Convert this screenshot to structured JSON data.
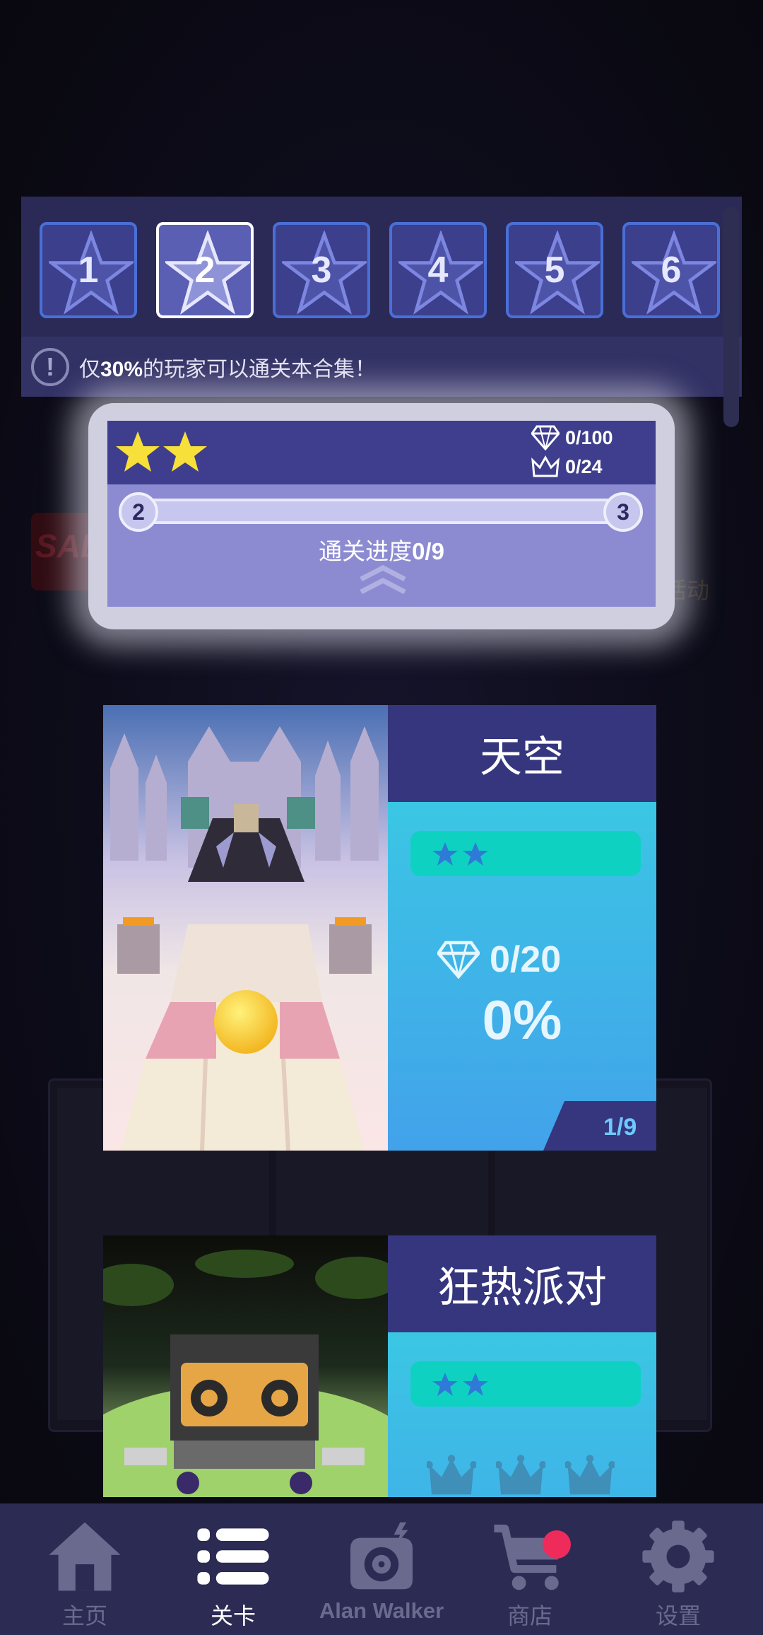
{
  "level_selector": {
    "levels": [
      {
        "number": "1",
        "active": false
      },
      {
        "number": "2",
        "active": true
      },
      {
        "number": "3",
        "active": false
      },
      {
        "number": "4",
        "active": false
      },
      {
        "number": "5",
        "active": false
      },
      {
        "number": "6",
        "active": false
      }
    ],
    "notice": {
      "prefix": "仅",
      "highlight": "30%",
      "suffix": "的玩家可以通关本合集！"
    }
  },
  "progress_card": {
    "stars_earned": 2,
    "gems": "0/100",
    "crowns": "0/24",
    "track_start": "2",
    "track_end": "3",
    "progress_label": "通关进度",
    "progress_value": "0/9"
  },
  "cards": [
    {
      "title": "天空",
      "stars": 2,
      "gems": "0/20",
      "percent": "0%",
      "count": "1/9"
    },
    {
      "title": "狂热派对",
      "stars": 2
    }
  ],
  "background": {
    "sale_text": "SAL",
    "right_text": "活动"
  },
  "bottom_nav": [
    {
      "label": "主页",
      "icon": "home-icon",
      "active": false
    },
    {
      "label": "关卡",
      "icon": "list-icon",
      "active": true
    },
    {
      "label": "Alan Walker",
      "icon": "alan-walker-icon",
      "active": false
    },
    {
      "label": "商店",
      "icon": "cart-icon",
      "active": false,
      "badge": true
    },
    {
      "label": "设置",
      "icon": "gear-icon",
      "active": false
    }
  ],
  "colors": {
    "accent": "#4a6fd6",
    "badge": "#ef2b5b",
    "star": "#f7e03a"
  }
}
